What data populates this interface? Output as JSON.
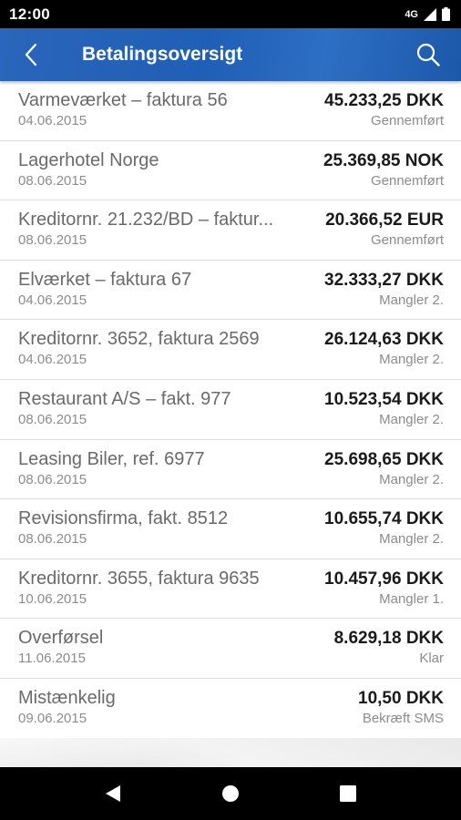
{
  "status_bar": {
    "time": "12:00",
    "network": "4G"
  },
  "app_bar": {
    "title": "Betalingsoversigt",
    "back_icon": "chevron-left-icon",
    "search_icon": "search-icon",
    "color": "#2466b8"
  },
  "payments": [
    {
      "name": "Varmeværket – faktura 56",
      "date": "04.06.2015",
      "amount": "45.233,25 DKK",
      "status": "Gennemført"
    },
    {
      "name": "Lagerhotel Norge",
      "date": "08.06.2015",
      "amount": "25.369,85 NOK",
      "status": "Gennemført"
    },
    {
      "name": "Kreditornr. 21.232/BD – faktur...",
      "date": "08.06.2015",
      "amount": "20.366,52 EUR",
      "status": "Gennemført"
    },
    {
      "name": "Elværket – faktura 67",
      "date": "04.06.2015",
      "amount": "32.333,27 DKK",
      "status": "Mangler 2."
    },
    {
      "name": "Kreditornr. 3652, faktura 2569",
      "date": "04.06.2015",
      "amount": "26.124,63 DKK",
      "status": "Mangler 2."
    },
    {
      "name": "Restaurant A/S – fakt. 977",
      "date": "08.06.2015",
      "amount": "10.523,54 DKK",
      "status": "Mangler 2."
    },
    {
      "name": "Leasing Biler, ref. 6977",
      "date": "08.06.2015",
      "amount": "25.698,65 DKK",
      "status": "Mangler 2."
    },
    {
      "name": "Revisionsfirma, fakt. 8512",
      "date": "08.06.2015",
      "amount": "10.655,74 DKK",
      "status": "Mangler 2."
    },
    {
      "name": "Kreditornr. 3655, faktura 9635",
      "date": "10.06.2015",
      "amount": "10.457,96 DKK",
      "status": "Mangler 1."
    },
    {
      "name": "Overførsel",
      "date": "11.06.2015",
      "amount": "8.629,18 DKK",
      "status": "Klar"
    },
    {
      "name": "Mistænkelig",
      "date": "09.06.2015",
      "amount": "10,50 DKK",
      "status": "Bekræft SMS"
    }
  ],
  "nav_bar": {
    "back_icon": "triangle-back-icon",
    "home_icon": "circle-home-icon",
    "recents_icon": "square-recents-icon"
  }
}
